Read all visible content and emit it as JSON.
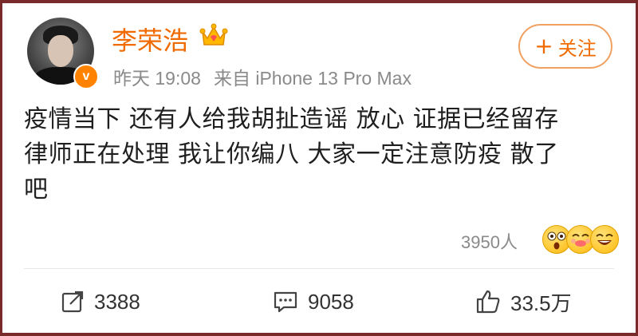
{
  "user": {
    "name": "李荣浩",
    "time": "昨天 19:08",
    "source": "来自 iPhone 13 Pro Max",
    "verified_icon": "v-badge-icon",
    "crown_icon": "crown-icon"
  },
  "follow_button": {
    "plus": "+",
    "label": "关注"
  },
  "post": {
    "text": "疫情当下 还有人给我胡扯造谣 放心 证据已经留存\n律师正在处理 我让你编八 大家一定注意防疫 散了\n吧"
  },
  "reactions": {
    "count": "3950人",
    "emojis": [
      "shocked-emoji-icon",
      "kiss-emoji-icon",
      "laugh-emoji-icon"
    ]
  },
  "actions": {
    "repost": {
      "icon": "repost-icon",
      "count": "3388"
    },
    "comment": {
      "icon": "comment-icon",
      "count": "9058"
    },
    "like": {
      "icon": "thumbs-up-icon",
      "count": "33.5万"
    }
  },
  "colors": {
    "accent": "#f06a00",
    "frame": "#7a2a2a",
    "meta": "#8a8a8a"
  }
}
